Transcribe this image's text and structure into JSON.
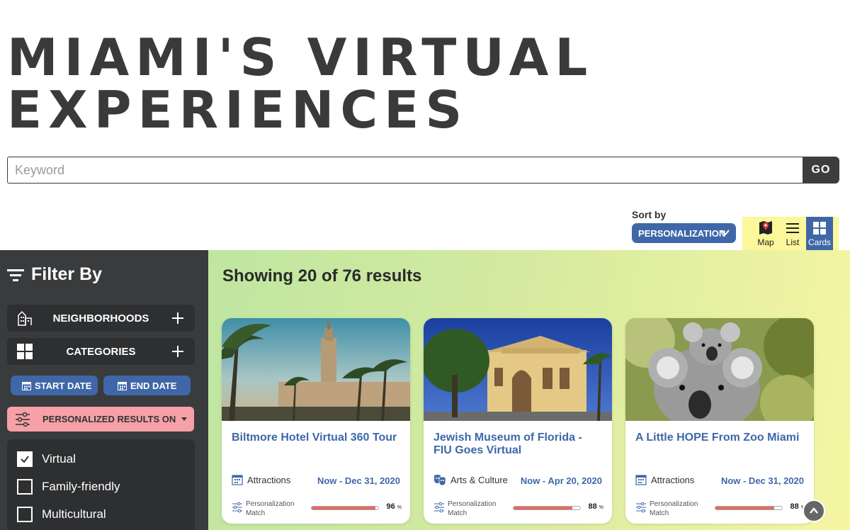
{
  "page": {
    "title_line1": "MIAMI'S VIRTUAL",
    "title_line2": "EXPERIENCES"
  },
  "search": {
    "placeholder": "Keyword",
    "go_label": "GO"
  },
  "sort": {
    "label": "Sort by",
    "selected": "PERSONALIZATION"
  },
  "view_toggle": {
    "map_label": "Map",
    "list_label": "List",
    "cards_label": "Cards",
    "active": "Cards"
  },
  "sidebar": {
    "heading": "Filter By",
    "neighborhoods_label": "NEIGHBORHOODS",
    "categories_label": "CATEGORIES",
    "start_date_label": "START DATE",
    "end_date_label": "END DATE",
    "personalized_label": "PERSONALIZED RESULTS ON",
    "checkboxes": [
      {
        "label": "Virtual",
        "checked": true
      },
      {
        "label": "Family-friendly",
        "checked": false
      },
      {
        "label": "Multicultural",
        "checked": false
      }
    ]
  },
  "results": {
    "summary": "Showing 20 of 76 results"
  },
  "cards": [
    {
      "title": "Biltmore Hotel Virtual 360 Tour",
      "category": "Attractions",
      "category_icon": "calendar-icon",
      "date_range": "Now - Dec 31, 2020",
      "match_label_line1": "Personalization",
      "match_label_line2": "Match",
      "match_percent": 96,
      "match_text": "96"
    },
    {
      "title": "Jewish Museum of Florida - FIU Goes Virtual",
      "category": "Arts & Culture",
      "category_icon": "theater-masks-icon",
      "date_range": "Now - Apr 20, 2020",
      "match_label_line1": "Personalization",
      "match_label_line2": "Match",
      "match_percent": 88,
      "match_text": "88"
    },
    {
      "title": "A Little HOPE From Zoo Miami",
      "category": "Attractions",
      "category_icon": "calendar-icon",
      "date_range": "Now - Dec 31, 2020",
      "match_label_line1": "Personalization",
      "match_label_line2": "Match",
      "match_percent": 88,
      "match_text": "88"
    }
  ],
  "colors": {
    "brand_blue": "#3f67a8",
    "sidebar_bg": "#3a3b3d",
    "personalized_pink": "#f6a0a7",
    "match_bar": "#e56a5f",
    "view_toggle_bg": "#fbf79a"
  }
}
